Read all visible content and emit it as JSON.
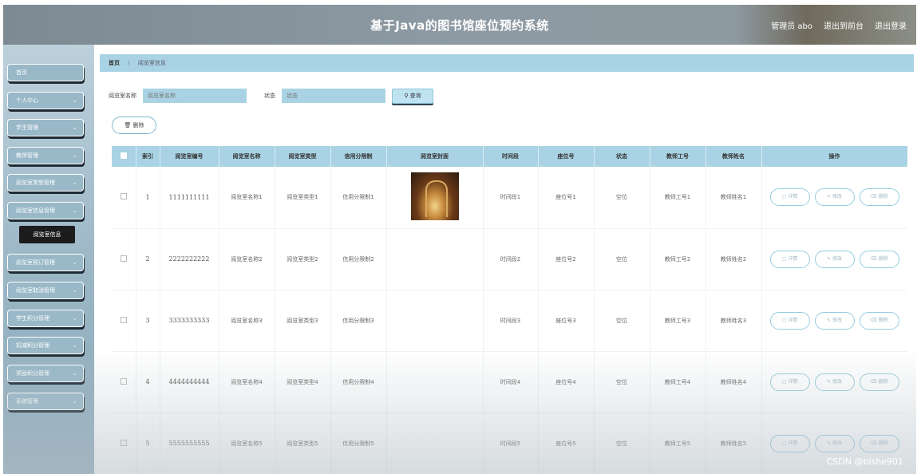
{
  "header": {
    "title": "基于Java的图书馆座位预约系统",
    "user_label": "管理员 abo",
    "back_label": "退出到前台",
    "logout_label": "退出登录"
  },
  "sidebar": {
    "items": [
      {
        "label": "首页",
        "has_chevron": false
      },
      {
        "label": "个人中心",
        "has_chevron": true
      },
      {
        "label": "学生管理",
        "has_chevron": true
      },
      {
        "label": "教师管理",
        "has_chevron": true
      },
      {
        "label": "阅览室类型管理",
        "has_chevron": true
      },
      {
        "label": "阅览室信息管理",
        "has_chevron": true
      },
      {
        "label": "阅览室预订管理",
        "has_chevron": true
      },
      {
        "label": "阅览室取消管理",
        "has_chevron": true
      },
      {
        "label": "学生积分管理",
        "has_chevron": true
      },
      {
        "label": "扣减积分管理",
        "has_chevron": true
      },
      {
        "label": "奖励积分管理",
        "has_chevron": true
      },
      {
        "label": "系统管理",
        "has_chevron": true
      }
    ],
    "active_sub": "阅览室信息"
  },
  "breadcrumb": {
    "home": "首页",
    "current": "阅览室信息"
  },
  "search": {
    "name_label": "阅览室名称",
    "name_placeholder": "阅览室名称",
    "status_label": "状态",
    "status_placeholder": "状态",
    "query_label": "查询"
  },
  "toolbar": {
    "delete_label": "删除"
  },
  "table": {
    "columns": [
      "索引",
      "阅览室编号",
      "阅览室名称",
      "阅览室类型",
      "信用分限制",
      "阅览室封面",
      "时间段",
      "座位号",
      "状态",
      "教师工号",
      "教师姓名",
      "操作"
    ],
    "rows": [
      {
        "index": "1",
        "code": "1111111111",
        "name": "阅览室名称1",
        "type": "阅览室类型1",
        "credit": "信用分限制1",
        "has_cover": true,
        "period": "时间段1",
        "seat": "座位号1",
        "status": "空位",
        "teacher_id": "教师工号1",
        "teacher_name": "教师姓名1"
      },
      {
        "index": "2",
        "code": "2222222222",
        "name": "阅览室名称2",
        "type": "阅览室类型2",
        "credit": "信用分限制2",
        "has_cover": false,
        "period": "时间段2",
        "seat": "座位号2",
        "status": "空位",
        "teacher_id": "教师工号2",
        "teacher_name": "教师姓名2"
      },
      {
        "index": "3",
        "code": "3333333333",
        "name": "阅览室名称3",
        "type": "阅览室类型3",
        "credit": "信用分限制3",
        "has_cover": false,
        "period": "时间段3",
        "seat": "座位号3",
        "status": "空位",
        "teacher_id": "教师工号3",
        "teacher_name": "教师姓名3"
      },
      {
        "index": "4",
        "code": "4444444444",
        "name": "阅览室名称4",
        "type": "阅览室类型4",
        "credit": "信用分限制4",
        "has_cover": false,
        "period": "时间段4",
        "seat": "座位号4",
        "status": "空位",
        "teacher_id": "教师工号4",
        "teacher_name": "教师姓名4"
      },
      {
        "index": "5",
        "code": "5555555555",
        "name": "阅览室名称5",
        "type": "阅览室类型5",
        "credit": "信用分限制5",
        "has_cover": false,
        "period": "时间段5",
        "seat": "座位号5",
        "status": "空位",
        "teacher_id": "教师工号5",
        "teacher_name": "教师姓名5"
      }
    ],
    "actions": {
      "detail": "详情",
      "edit": "修改",
      "delete": "删除"
    }
  },
  "watermark": "CSDN @bishe901",
  "colors": {
    "accent": "#a9d3e4",
    "header_bg": "#8d9aa3",
    "sidebar_bg": "#9ab5c4",
    "active_menu": "#1c1c1c"
  }
}
